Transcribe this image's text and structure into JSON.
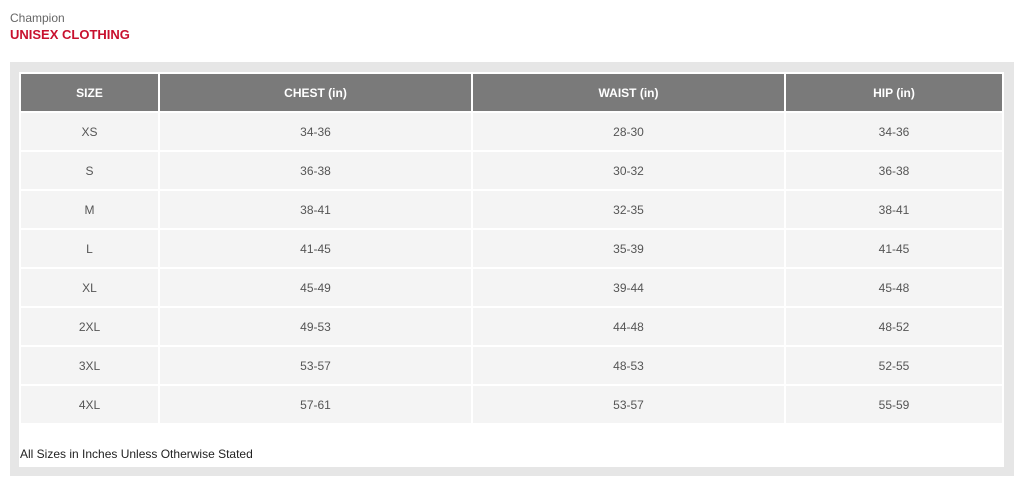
{
  "header": {
    "brand": "Champion",
    "category": "UNISEX CLOTHING"
  },
  "colors": {
    "accent": "#c8102e",
    "header_bg": "#7a7a7a",
    "row_bg": "#f4f4f4",
    "panel_bg": "#e6e6e6"
  },
  "table": {
    "columns": [
      "SIZE",
      "CHEST (in)",
      "WAIST (in)",
      "HIP (in)"
    ],
    "rows": [
      [
        "XS",
        "34-36",
        "28-30",
        "34-36"
      ],
      [
        "S",
        "36-38",
        "30-32",
        "36-38"
      ],
      [
        "M",
        "38-41",
        "32-35",
        "38-41"
      ],
      [
        "L",
        "41-45",
        "35-39",
        "41-45"
      ],
      [
        "XL",
        "45-49",
        "39-44",
        "45-48"
      ],
      [
        "2XL",
        "49-53",
        "44-48",
        "48-52"
      ],
      [
        "3XL",
        "53-57",
        "48-53",
        "52-55"
      ],
      [
        "4XL",
        "57-61",
        "53-57",
        "55-59"
      ]
    ]
  },
  "footnote": "All Sizes in Inches Unless Otherwise Stated"
}
